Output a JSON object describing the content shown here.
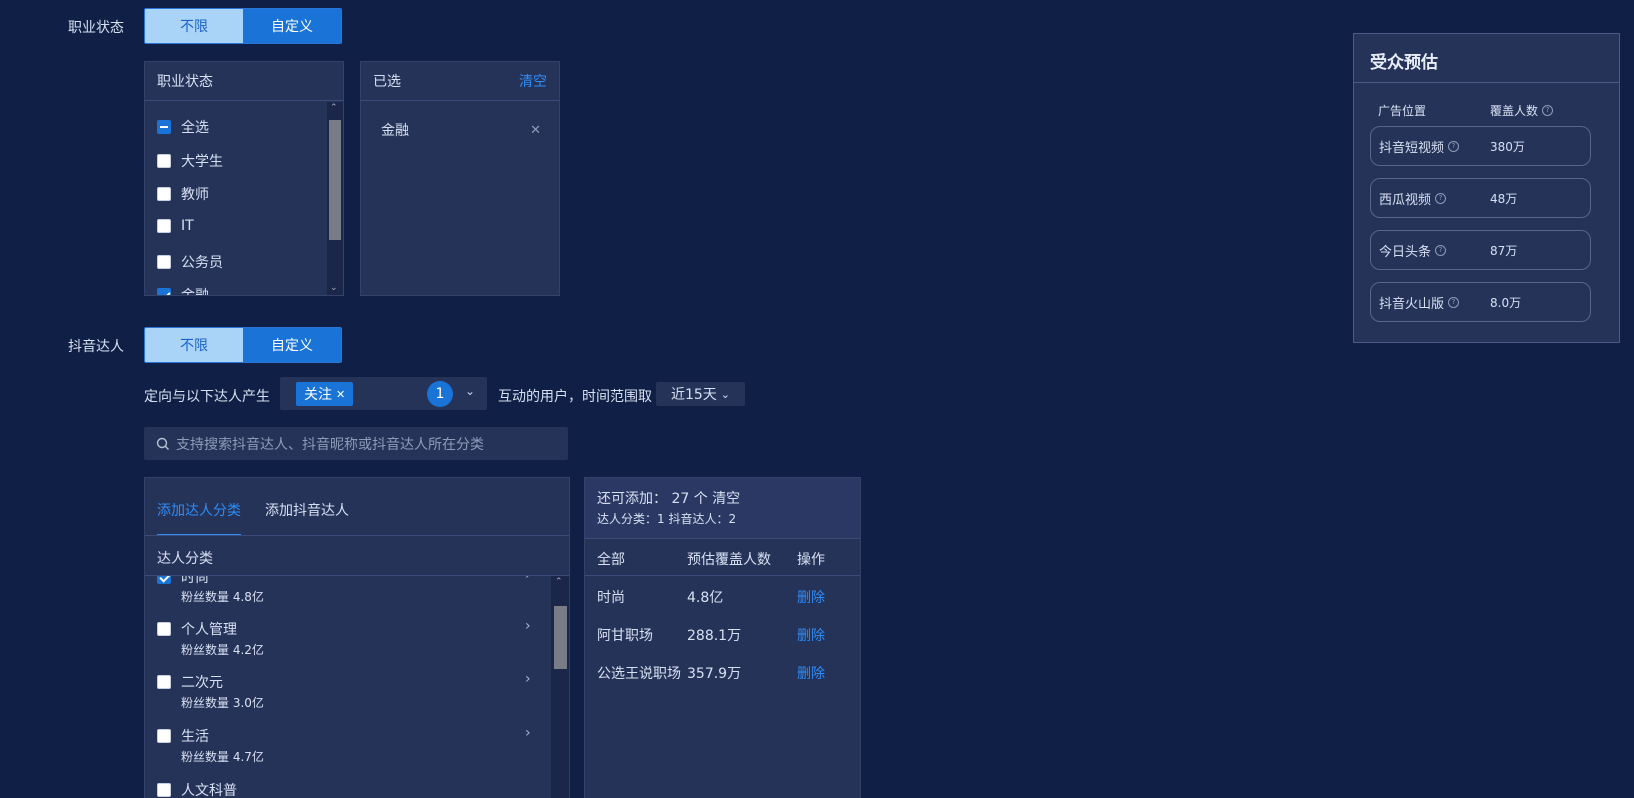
{
  "occupation": {
    "label": "职业状态",
    "options": [
      "不限",
      "自定义"
    ],
    "list_title": "职业状态",
    "items": [
      {
        "label": "全选",
        "state": "indeterminate"
      },
      {
        "label": "大学生",
        "state": "unchecked"
      },
      {
        "label": "教师",
        "state": "unchecked"
      },
      {
        "label": "IT",
        "state": "unchecked"
      },
      {
        "label": "公务员",
        "state": "unchecked"
      },
      {
        "label": "金融",
        "state": "checked"
      }
    ],
    "selected_title": "已选",
    "clear_label": "清空",
    "selected": [
      "金融"
    ]
  },
  "influencer": {
    "label": "抖音达人",
    "options": [
      "不限",
      "自定义"
    ],
    "sentence_prefix": "定向与以下达人产生",
    "tag": "关注",
    "tag_count": "1",
    "sentence_suffix": "互动的用户，时间范围取",
    "time_range": "近15天",
    "search_placeholder": "支持搜索抖音达人、抖音昵称或抖音达人所在分类",
    "tabs": [
      "添加达人分类",
      "添加抖音达人"
    ],
    "category_header": "达人分类",
    "categories": [
      {
        "name": "时尚",
        "fans": "粉丝数量 4.8亿",
        "state": "checked"
      },
      {
        "name": "个人管理",
        "fans": "粉丝数量 4.2亿",
        "state": "unchecked"
      },
      {
        "name": "二次元",
        "fans": "粉丝数量 3.0亿",
        "state": "unchecked"
      },
      {
        "name": "生活",
        "fans": "粉丝数量 4.7亿",
        "state": "unchecked"
      },
      {
        "name": "人文科普",
        "fans": "",
        "state": "unchecked"
      }
    ],
    "summary": {
      "line1_prefix": "还可添加：",
      "remaining": "27",
      "unit": "个",
      "clear": "清空",
      "line2": "达人分类：1 抖音达人：2"
    },
    "table": {
      "headers": [
        "全部",
        "预估覆盖人数",
        "操作"
      ],
      "rows": [
        {
          "name": "时尚",
          "coverage": "4.8亿",
          "action": "删除"
        },
        {
          "name": "阿甘职场",
          "coverage": "288.1万",
          "action": "删除"
        },
        {
          "name": "公选王说职场",
          "coverage": "357.9万",
          "action": "删除"
        }
      ]
    }
  },
  "estimate": {
    "title": "受众预估",
    "col1": "广告位置",
    "col2": "覆盖人数",
    "rows": [
      {
        "placement": "抖音短视频",
        "count": "380万"
      },
      {
        "placement": "西瓜视频",
        "count": "48万"
      },
      {
        "placement": "今日头条",
        "count": "87万"
      },
      {
        "placement": "抖音火山版",
        "count": "8.0万"
      }
    ]
  },
  "colors": {
    "background": "#0f1f45",
    "panel": "#263359",
    "accent": "#1a74d8",
    "link": "#2f8cf5"
  }
}
